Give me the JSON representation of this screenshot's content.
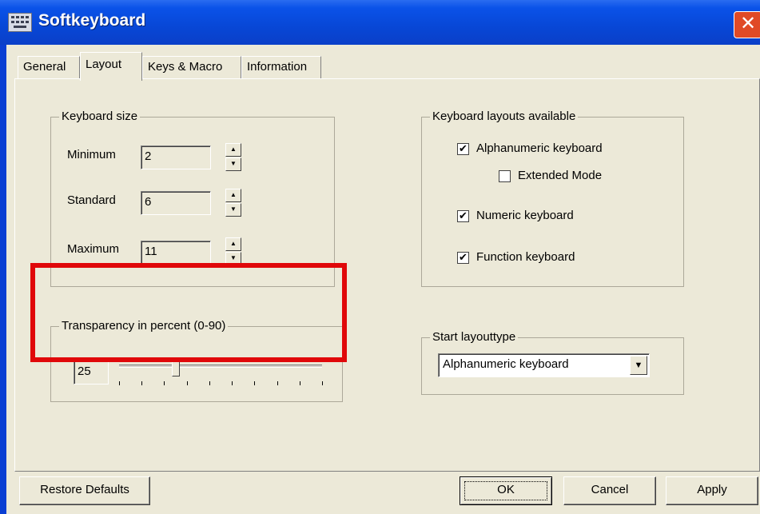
{
  "window": {
    "title": "Softkeyboard",
    "close_glyph": "✕"
  },
  "tabs": [
    {
      "label": "General"
    },
    {
      "label": "Layout"
    },
    {
      "label": "Keys & Macro"
    },
    {
      "label": "Information"
    }
  ],
  "keyboard_size": {
    "label": "Keyboard size",
    "minimum_label": "Minimum",
    "minimum_value": "2",
    "standard_label": "Standard",
    "standard_value": "6",
    "maximum_label": "Maximum",
    "maximum_value": "11"
  },
  "transparency": {
    "label": "Transparency in percent (0-90)",
    "value": "25",
    "slider_min": 0,
    "slider_max": 90,
    "slider_value": 25
  },
  "layouts": {
    "label": "Keyboard layouts available",
    "alphanumeric": {
      "label": "Alphanumeric keyboard",
      "checked": true
    },
    "extended": {
      "label": "Extended Mode",
      "checked": false
    },
    "numeric": {
      "label": "Numeric keyboard",
      "checked": true
    },
    "function": {
      "label": "Function keyboard",
      "checked": true
    }
  },
  "start_layout": {
    "label": "Start layouttype",
    "selected": "Alphanumeric keyboard"
  },
  "buttons": {
    "restore": "Restore Defaults",
    "ok": "OK",
    "cancel": "Cancel",
    "apply": "Apply"
  },
  "icons": {
    "spin_up": "▲",
    "spin_down": "▼",
    "dropdown_arrow": "▼",
    "check": "✔"
  },
  "colors": {
    "titlebar": "#0a52e8",
    "dialog_bg": "#ece9d8",
    "highlight": "#e0080a",
    "close": "#e04a26"
  }
}
